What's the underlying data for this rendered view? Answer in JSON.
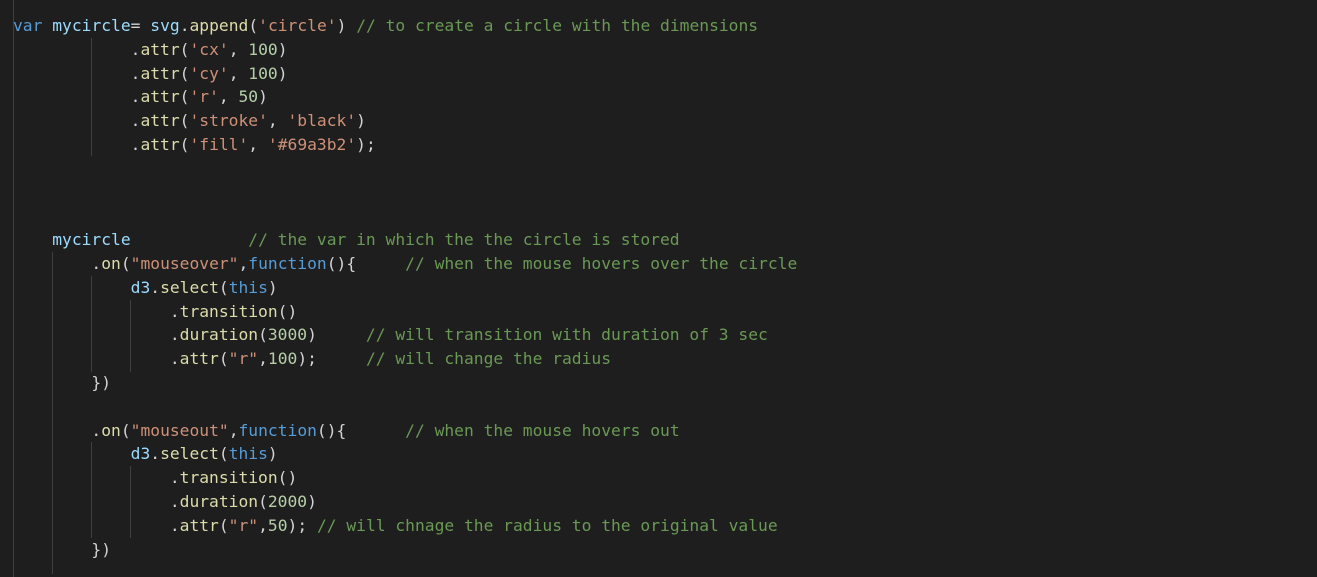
{
  "theme": {
    "background": "#1e1e1e",
    "keyword": "#569cd6",
    "variable": "#9cdcfe",
    "function": "#dcdcaa",
    "string": "#ce9178",
    "number": "#b5cea8",
    "comment": "#6a9955",
    "text": "#d4d4d4",
    "indent_guide": "#404040"
  },
  "code_lines": [
    {
      "row": 0,
      "tokens": [
        [
          "kw",
          "var"
        ],
        [
          "plain",
          " "
        ],
        [
          "var",
          "mycircle"
        ],
        [
          "plain",
          "= "
        ],
        [
          "var",
          "svg"
        ],
        [
          "plain",
          "."
        ],
        [
          "fn",
          "append"
        ],
        [
          "punc",
          "("
        ],
        [
          "str",
          "'circle'"
        ],
        [
          "punc",
          ")"
        ],
        [
          "plain",
          " "
        ],
        [
          "cmt",
          "// to create a circle with the dimensions"
        ]
      ]
    },
    {
      "row": 1,
      "tokens": [
        [
          "plain",
          "            ."
        ],
        [
          "fn",
          "attr"
        ],
        [
          "punc",
          "("
        ],
        [
          "str",
          "'cx'"
        ],
        [
          "plain",
          ", "
        ],
        [
          "num",
          "100"
        ],
        [
          "punc",
          ")"
        ]
      ]
    },
    {
      "row": 2,
      "tokens": [
        [
          "plain",
          "            ."
        ],
        [
          "fn",
          "attr"
        ],
        [
          "punc",
          "("
        ],
        [
          "str",
          "'cy'"
        ],
        [
          "plain",
          ", "
        ],
        [
          "num",
          "100"
        ],
        [
          "punc",
          ")"
        ]
      ]
    },
    {
      "row": 3,
      "tokens": [
        [
          "plain",
          "            ."
        ],
        [
          "fn",
          "attr"
        ],
        [
          "punc",
          "("
        ],
        [
          "str",
          "'r'"
        ],
        [
          "plain",
          ", "
        ],
        [
          "num",
          "50"
        ],
        [
          "punc",
          ")"
        ]
      ]
    },
    {
      "row": 4,
      "tokens": [
        [
          "plain",
          "            ."
        ],
        [
          "fn",
          "attr"
        ],
        [
          "punc",
          "("
        ],
        [
          "str",
          "'stroke'"
        ],
        [
          "plain",
          ", "
        ],
        [
          "str",
          "'black'"
        ],
        [
          "punc",
          ")"
        ]
      ]
    },
    {
      "row": 5,
      "tokens": [
        [
          "plain",
          "            ."
        ],
        [
          "fn",
          "attr"
        ],
        [
          "punc",
          "("
        ],
        [
          "str",
          "'fill'"
        ],
        [
          "plain",
          ", "
        ],
        [
          "str",
          "'#69a3b2'"
        ],
        [
          "punc",
          ");"
        ]
      ]
    },
    {
      "row": 9,
      "tokens": [
        [
          "plain",
          "    "
        ],
        [
          "var",
          "mycircle"
        ],
        [
          "plain",
          "            "
        ],
        [
          "cmt",
          "// the var in which the the circle is stored"
        ]
      ]
    },
    {
      "row": 10,
      "tokens": [
        [
          "plain",
          "        ."
        ],
        [
          "fn",
          "on"
        ],
        [
          "punc",
          "("
        ],
        [
          "str",
          "\"mouseover\""
        ],
        [
          "plain",
          ","
        ],
        [
          "kw",
          "function"
        ],
        [
          "punc",
          "(){"
        ],
        [
          "plain",
          "     "
        ],
        [
          "cmt",
          "// when the mouse hovers over the circle"
        ]
      ]
    },
    {
      "row": 11,
      "tokens": [
        [
          "plain",
          "            "
        ],
        [
          "var",
          "d3"
        ],
        [
          "plain",
          "."
        ],
        [
          "fn",
          "select"
        ],
        [
          "punc",
          "("
        ],
        [
          "kw",
          "this"
        ],
        [
          "punc",
          ")"
        ]
      ]
    },
    {
      "row": 12,
      "tokens": [
        [
          "plain",
          "                ."
        ],
        [
          "fn",
          "transition"
        ],
        [
          "punc",
          "()"
        ]
      ]
    },
    {
      "row": 13,
      "tokens": [
        [
          "plain",
          "                ."
        ],
        [
          "fn",
          "duration"
        ],
        [
          "punc",
          "("
        ],
        [
          "num",
          "3000"
        ],
        [
          "punc",
          ")"
        ],
        [
          "plain",
          "     "
        ],
        [
          "cmt",
          "// will transition with duration of 3 sec"
        ]
      ]
    },
    {
      "row": 14,
      "tokens": [
        [
          "plain",
          "                ."
        ],
        [
          "fn",
          "attr"
        ],
        [
          "punc",
          "("
        ],
        [
          "str",
          "\"r\""
        ],
        [
          "plain",
          ","
        ],
        [
          "num",
          "100"
        ],
        [
          "punc",
          ");"
        ],
        [
          "plain",
          "     "
        ],
        [
          "cmt",
          "// will change the radius"
        ]
      ]
    },
    {
      "row": 15,
      "tokens": [
        [
          "plain",
          "        "
        ],
        [
          "punc",
          "})"
        ]
      ]
    },
    {
      "row": 17,
      "tokens": [
        [
          "plain",
          "        ."
        ],
        [
          "fn",
          "on"
        ],
        [
          "punc",
          "("
        ],
        [
          "str",
          "\"mouseout\""
        ],
        [
          "plain",
          ","
        ],
        [
          "kw",
          "function"
        ],
        [
          "punc",
          "(){"
        ],
        [
          "plain",
          "      "
        ],
        [
          "cmt",
          "// when the mouse hovers out"
        ]
      ]
    },
    {
      "row": 18,
      "tokens": [
        [
          "plain",
          "            "
        ],
        [
          "var",
          "d3"
        ],
        [
          "plain",
          "."
        ],
        [
          "fn",
          "select"
        ],
        [
          "punc",
          "("
        ],
        [
          "kw",
          "this"
        ],
        [
          "punc",
          ")"
        ]
      ]
    },
    {
      "row": 19,
      "tokens": [
        [
          "plain",
          "                ."
        ],
        [
          "fn",
          "transition"
        ],
        [
          "punc",
          "()"
        ]
      ]
    },
    {
      "row": 20,
      "tokens": [
        [
          "plain",
          "                ."
        ],
        [
          "fn",
          "duration"
        ],
        [
          "punc",
          "("
        ],
        [
          "num",
          "2000"
        ],
        [
          "punc",
          ")"
        ]
      ]
    },
    {
      "row": 21,
      "tokens": [
        [
          "plain",
          "                ."
        ],
        [
          "fn",
          "attr"
        ],
        [
          "punc",
          "("
        ],
        [
          "str",
          "\"r\""
        ],
        [
          "plain",
          ","
        ],
        [
          "num",
          "50"
        ],
        [
          "punc",
          ");"
        ],
        [
          "plain",
          " "
        ],
        [
          "cmt",
          "// will chnage the radius to the original value"
        ]
      ]
    },
    {
      "row": 22,
      "tokens": [
        [
          "plain",
          "        "
        ],
        [
          "punc",
          "})"
        ]
      ]
    }
  ]
}
